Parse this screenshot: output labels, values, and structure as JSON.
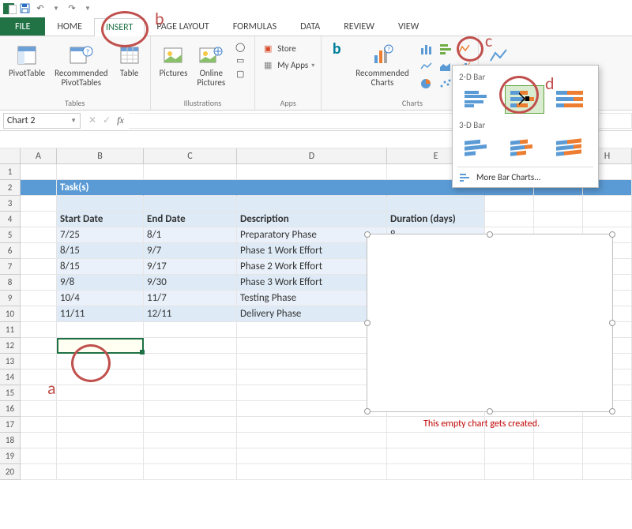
{
  "qat": {
    "undo": "↶",
    "redo": "↷"
  },
  "tabs": {
    "file": "FILE",
    "home": "HOME",
    "insert": "INSERT",
    "page_layout": "PAGE LAYOUT",
    "formulas": "FORMULAS",
    "data": "DATA",
    "review": "REVIEW",
    "view": "VIEW"
  },
  "ribbon": {
    "pivottable": "PivotTable",
    "rec_pivot": "Recommended\nPivotTables",
    "table": "Table",
    "tables_grp": "Tables",
    "pictures": "Pictures",
    "online_pics": "Online\nPictures",
    "illus_grp": "Illustrations",
    "store": "Store",
    "myapps": "My Apps",
    "apps_grp": "Apps",
    "rec_charts": "Recommended\nCharts",
    "charts_grp": "Charts",
    "line": "Line"
  },
  "bar_dd": {
    "sec1": "2-D Bar",
    "sec2": "3-D Bar",
    "more": "More Bar Charts..."
  },
  "namebox": "Chart 2",
  "cols": [
    "A",
    "B",
    "C",
    "D",
    "E",
    "F",
    "G",
    "H"
  ],
  "table": {
    "title": "Task(s)",
    "headers": [
      "Start Date",
      "End Date",
      "Description",
      "Duration (days)"
    ],
    "rows": [
      [
        "7/25",
        "8/1",
        "Preparatory Phase",
        "8"
      ],
      [
        "8/15",
        "9/7",
        "Phase 1 Work Effort",
        ""
      ],
      [
        "8/15",
        "9/17",
        "Phase 2 Work Effort",
        ""
      ],
      [
        "9/8",
        "9/30",
        "Phase 3 Work Effort",
        ""
      ],
      [
        "10/4",
        "11/7",
        "Testing Phase",
        ""
      ],
      [
        "11/11",
        "12/11",
        "Delivery Phase",
        ""
      ]
    ]
  },
  "chart_note": "This empty chart gets created.",
  "ann": {
    "a": "a",
    "b": "b",
    "c": "c",
    "d": "d"
  },
  "chart_data": {
    "type": "bar",
    "title": "",
    "categories": [],
    "values": [],
    "note": "empty chart placeholder"
  }
}
